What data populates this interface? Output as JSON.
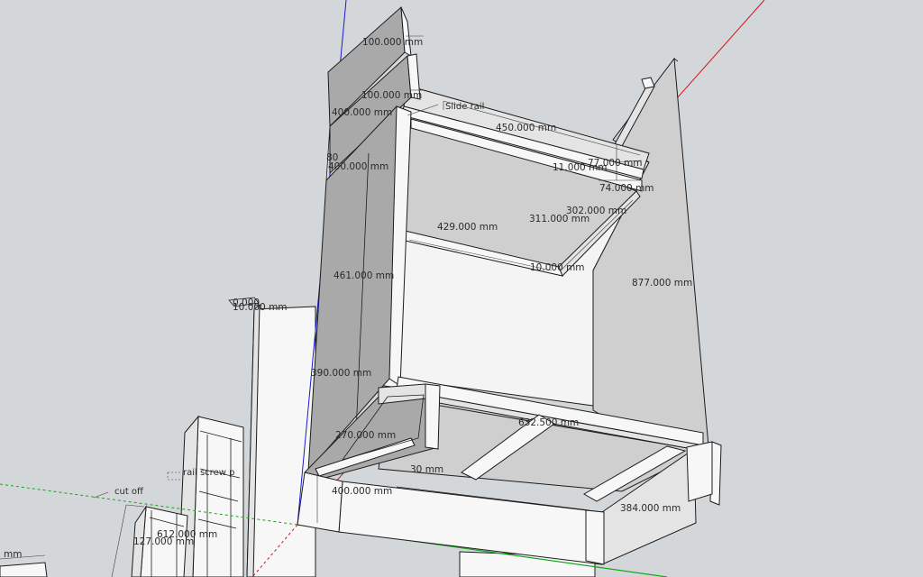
{
  "dimensions": [
    "100.000 mm",
    "100.000 mm",
    "400.000 mm",
    "80",
    "400.000 mm",
    "450.000 mm",
    "77.000 mm",
    "11.000 mm",
    "74.000 mm",
    "302.000 mm",
    "311.000 mm",
    "429.000 mm",
    "10.000 mm",
    "877.000 mm",
    "461.000 mm",
    "0.000",
    "10.000 mm",
    "390.000 mm",
    "632.500 mm",
    "270.000 mm",
    "30 mm",
    "400.000 mm",
    "384.000 mm",
    "612.000 mm",
    "127.000 mm",
    "mm"
  ],
  "notes": {
    "slide_rail": "Slide rail",
    "cut_off": "cut off",
    "rail_screw": "rail screw p"
  },
  "axes": {
    "red": "#d0141e",
    "green": "#16a516",
    "blue": "#1a1ad0"
  },
  "colors": {
    "background": "#d4d7d9",
    "edges": "#1c1c1c"
  }
}
